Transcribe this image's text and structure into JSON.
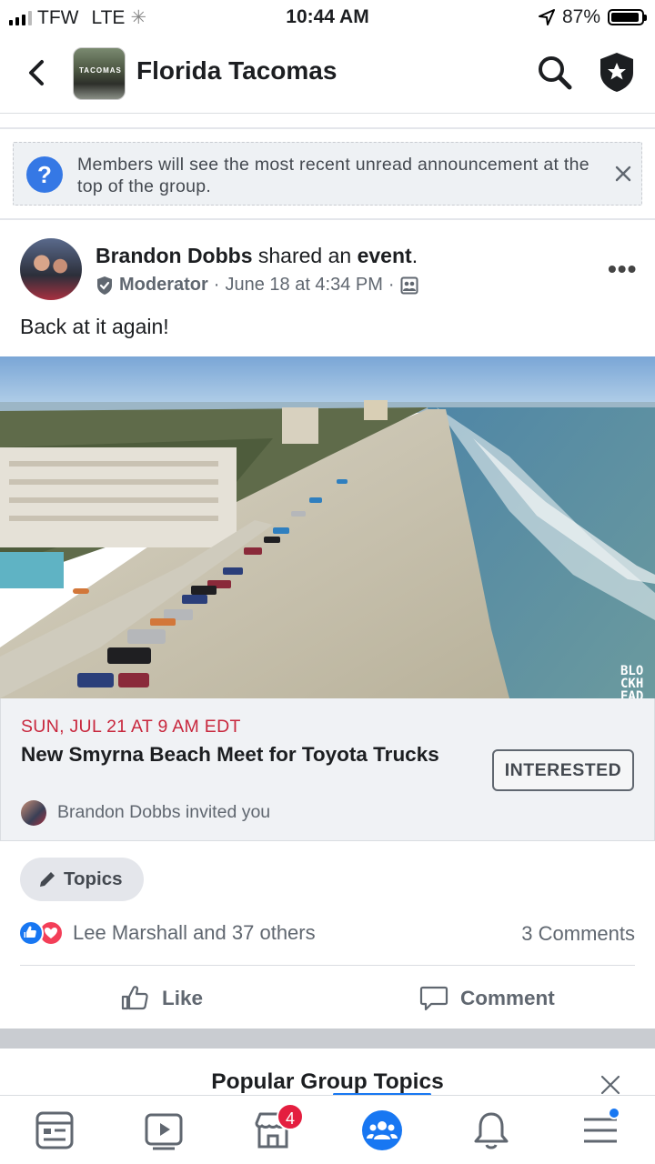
{
  "status_bar": {
    "carrier": "TFW",
    "network": "LTE",
    "time": "10:44 AM",
    "battery": "87%"
  },
  "header": {
    "group_name": "Florida Tacomas",
    "thumb_text": "TACOMAS"
  },
  "announcement": {
    "text": "Members will see the most recent unread announcement at the top of the group."
  },
  "post": {
    "author": "Brandon Dobbs",
    "action_text": " shared an ",
    "action_object": "event",
    "action_end": ".",
    "role": "Moderator",
    "sep1": "·",
    "timestamp": "June 18 at 4:34 PM",
    "sep2": "·",
    "text": "Back at it again!",
    "photo_watermark": [
      "BLO",
      "CKH",
      "EAD"
    ]
  },
  "event": {
    "date": "SUN, JUL 21 AT 9 AM EDT",
    "title": "New Smyrna Beach Meet for Toyota Trucks",
    "interested_label": "INTERESTED",
    "invited_text": "Brandon Dobbs invited you"
  },
  "topics_chip": {
    "label": "Topics"
  },
  "reactions": {
    "text": "Lee Marshall and 37 others",
    "comments": "3 Comments"
  },
  "actions": {
    "like": "Like",
    "comment": "Comment"
  },
  "popular": {
    "title": "Popular Group Topics"
  },
  "tabbar": {
    "marketplace_badge": "4"
  },
  "colors": {
    "brand_blue": "#1877f2",
    "event_red": "#c8273d",
    "badge_red": "#e41e3f"
  }
}
